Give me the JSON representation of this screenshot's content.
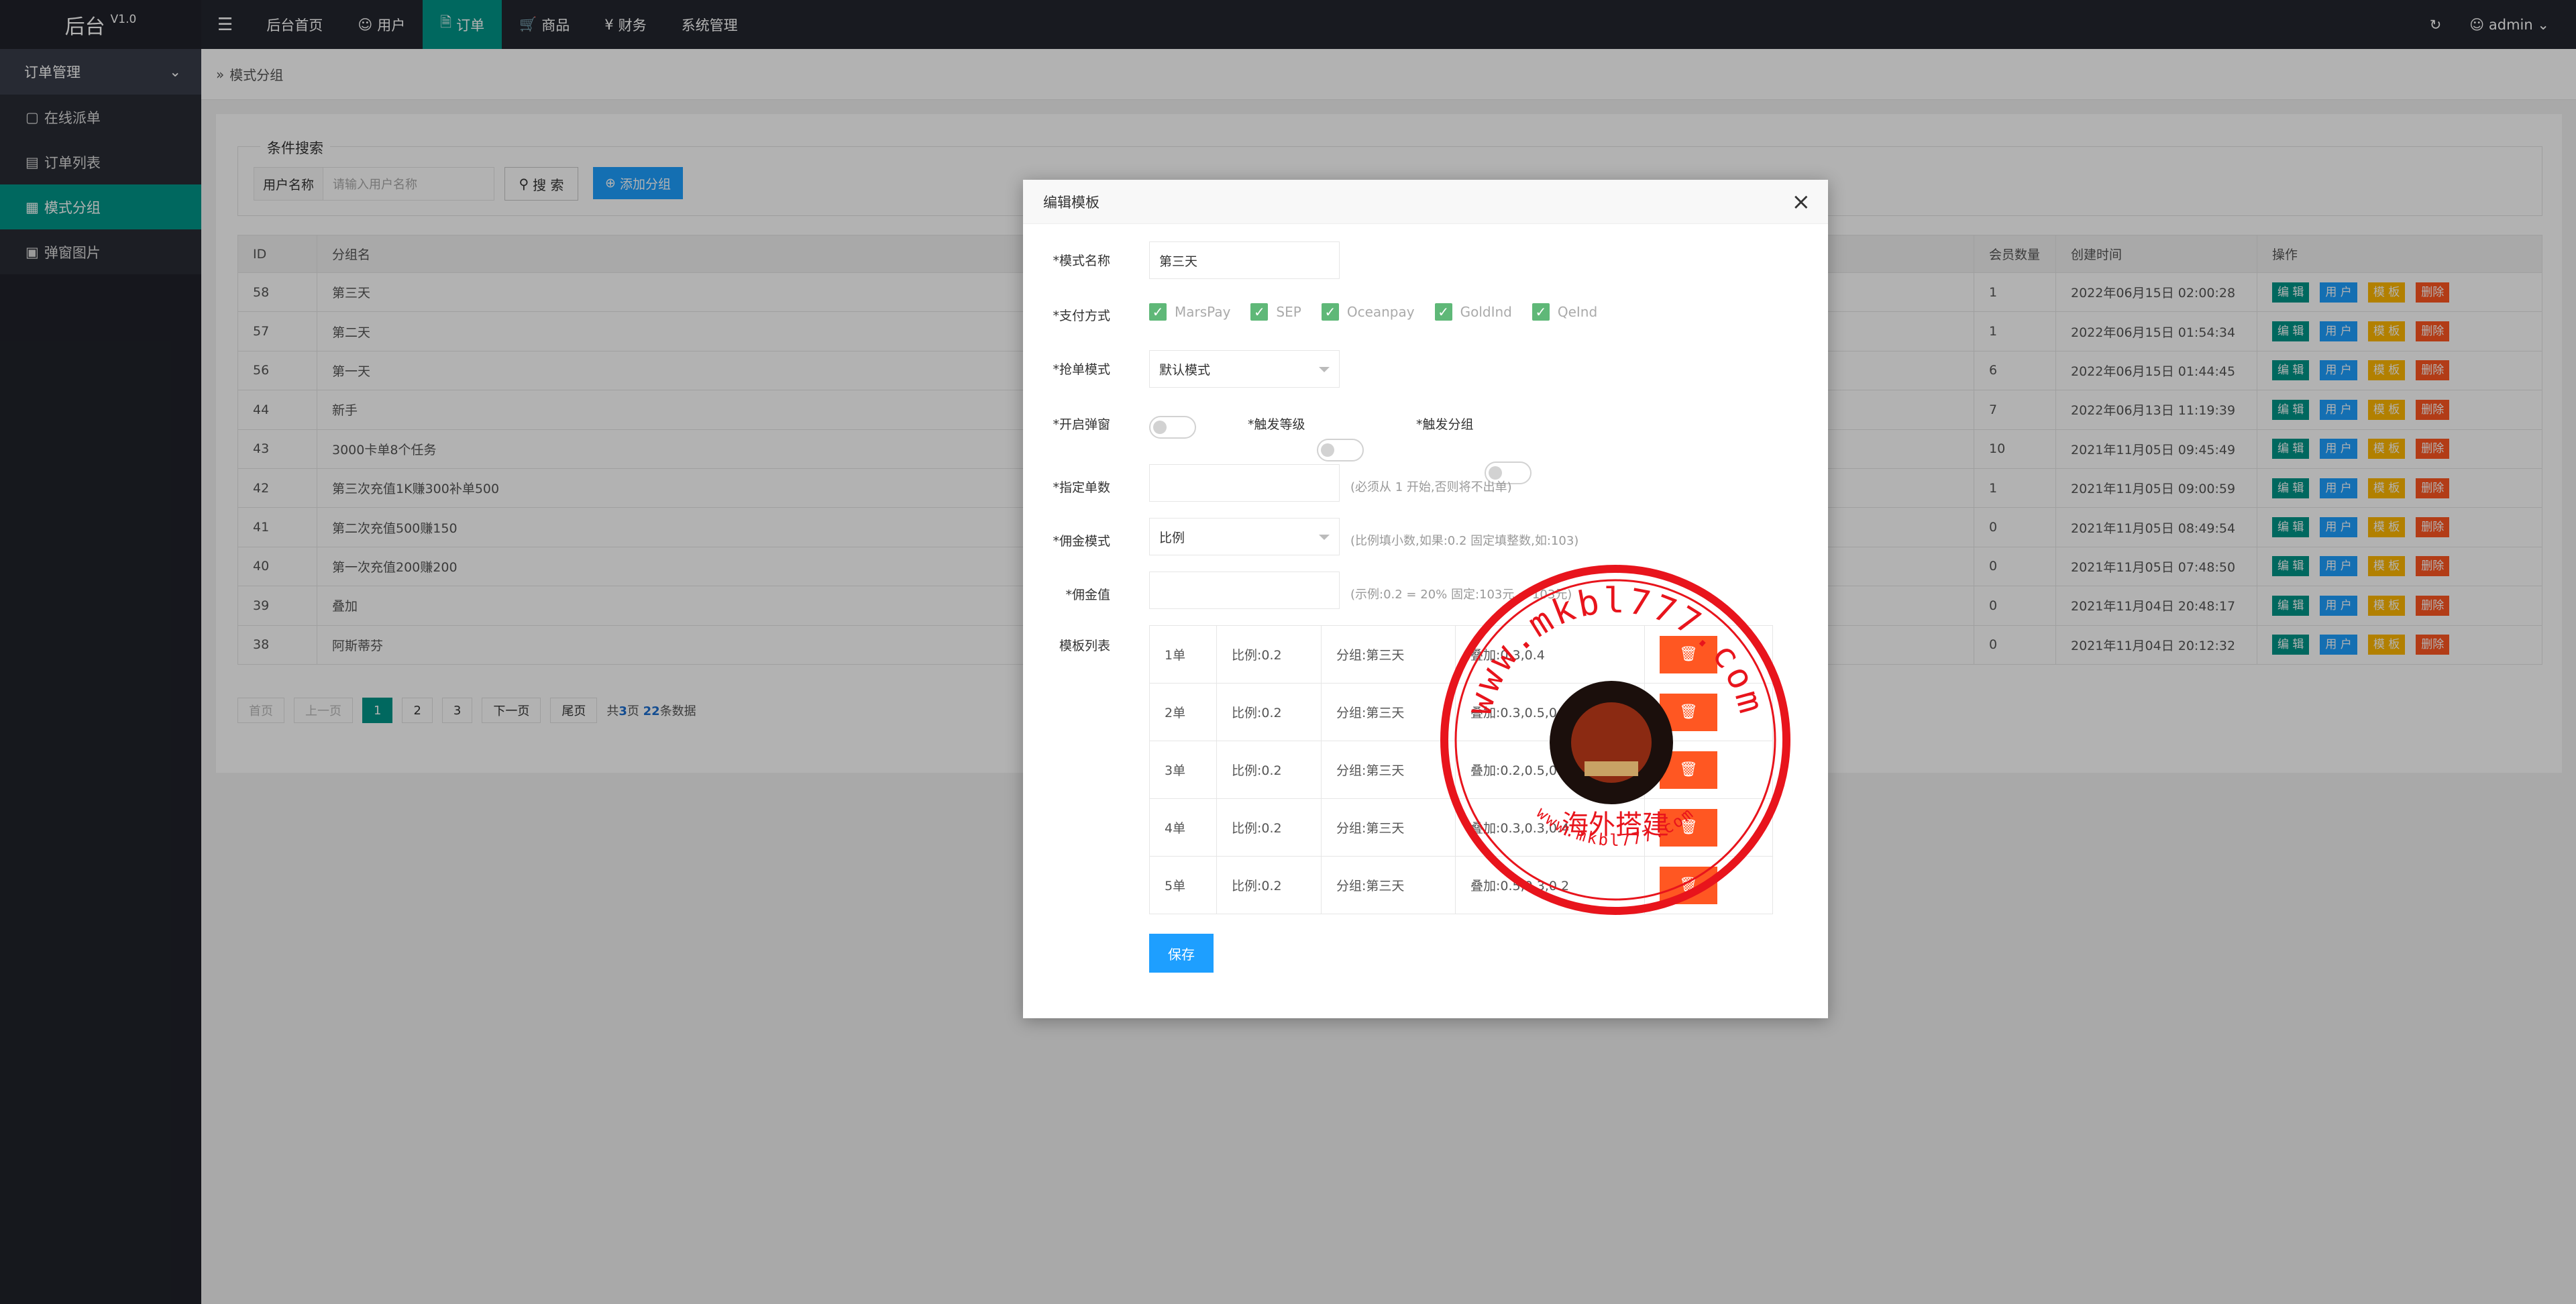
{
  "header": {
    "logo": "后台",
    "version": "V1.0",
    "nav": [
      {
        "label": "后台首页",
        "icon": ""
      },
      {
        "label": "用户",
        "icon": "user-icon"
      },
      {
        "label": "订单",
        "icon": "document-icon",
        "active": true
      },
      {
        "label": "商品",
        "icon": "cart-icon"
      },
      {
        "label": "财务",
        "icon": "yen-icon"
      },
      {
        "label": "系统管理",
        "icon": ""
      }
    ],
    "user": "admin"
  },
  "sidebar": {
    "section": "订单管理",
    "items": [
      {
        "label": "在线派单",
        "icon": "clipboard-icon"
      },
      {
        "label": "订单列表",
        "icon": "list-icon"
      },
      {
        "label": "模式分组",
        "icon": "group-icon",
        "active": true
      },
      {
        "label": "弹窗图片",
        "icon": "image-icon"
      }
    ]
  },
  "breadcrumb": "模式分组",
  "search": {
    "legend": "条件搜索",
    "label": "用户名称",
    "placeholder": "请输入用户名称",
    "search_button": "搜 索",
    "add_button": "添加分组"
  },
  "table": {
    "headers": [
      "ID",
      "分组名",
      "会员数量",
      "创建时间",
      "操作"
    ],
    "rows": [
      {
        "id": "58",
        "name": "第三天",
        "members": "1",
        "created": "2022年06月15日 02:00:28"
      },
      {
        "id": "57",
        "name": "第二天",
        "members": "1",
        "created": "2022年06月15日 01:54:34"
      },
      {
        "id": "56",
        "name": "第一天",
        "members": "6",
        "created": "2022年06月15日 01:44:45"
      },
      {
        "id": "44",
        "name": "新手",
        "members": "7",
        "created": "2022年06月13日 11:19:39"
      },
      {
        "id": "43",
        "name": "3000卡单8个任务",
        "members": "10",
        "created": "2021年11月05日 09:45:49"
      },
      {
        "id": "42",
        "name": "第三次充值1K赚300补单500",
        "members": "1",
        "created": "2021年11月05日 09:00:59"
      },
      {
        "id": "41",
        "name": "第二次充值500赚150",
        "members": "0",
        "created": "2021年11月05日 08:49:54"
      },
      {
        "id": "40",
        "name": "第一次充值200赚200",
        "members": "0",
        "created": "2021年11月05日 07:48:50"
      },
      {
        "id": "39",
        "name": "叠加",
        "members": "0",
        "created": "2021年11月04日 20:48:17"
      },
      {
        "id": "38",
        "name": "阿斯蒂芬",
        "members": "0",
        "created": "2021年11月04日 20:12:32"
      }
    ],
    "actions": [
      "编 辑",
      "用 户",
      "模 板",
      "删除"
    ]
  },
  "pagination": {
    "first": "首页",
    "prev": "上一页",
    "pages": [
      "1",
      "2",
      "3"
    ],
    "current": "1",
    "next": "下一页",
    "last": "尾页",
    "info_prefix": "共",
    "total_pages": "3",
    "info_mid": "页 ",
    "total_records": "22",
    "info_suffix": "条数据"
  },
  "modal": {
    "title": "编辑模板",
    "close": "×",
    "fields": {
      "name_label": "*模式名称",
      "name_value": "第三天",
      "pay_label": "*支付方式",
      "pay_options": [
        "MarsPay",
        "SEP",
        "Oceanpay",
        "GoldInd",
        "QeInd"
      ],
      "grab_label": "*抢单模式",
      "grab_value": "默认模式",
      "popup_label": "*开启弹窗",
      "trigger_level_label": "*触发等级",
      "trigger_group_label": "*触发分组",
      "count_label": "*指定单数",
      "count_hint": "(必须从 1 开始,否则将不出单)",
      "commission_mode_label": "*佣金模式",
      "commission_mode_value": "比例",
      "commission_mode_hint": "(比例填小数,如果:0.2 固定填整数,如:103)",
      "commission_value_label": "*佣金值",
      "commission_value_hint": "(示例:0.2 = 20% 固定:103元 = 103元)",
      "template_label": "模板列表"
    },
    "template_rows": [
      {
        "order": "1单",
        "ratio": "比例:0.2",
        "group": "分组:第三天",
        "stack": "叠加:0.3,0.4"
      },
      {
        "order": "2单",
        "ratio": "比例:0.2",
        "group": "分组:第三天",
        "stack": "叠加:0.3,0.5,0.6"
      },
      {
        "order": "3单",
        "ratio": "比例:0.2",
        "group": "分组:第三天",
        "stack": "叠加:0.2,0.5,0.3"
      },
      {
        "order": "4单",
        "ratio": "比例:0.2",
        "group": "分组:第三天",
        "stack": "叠加:0.3,0.3,0.4"
      },
      {
        "order": "5单",
        "ratio": "比例:0.2",
        "group": "分组:第三天",
        "stack": "叠加:0.5,0.3,0.2"
      }
    ],
    "save": "保存"
  },
  "stamp": {
    "top_text": "www.mkbl777.com",
    "bottom_text": "www.mkbl777.com",
    "center_text": "海外搭建",
    "color": "#e8141c"
  }
}
